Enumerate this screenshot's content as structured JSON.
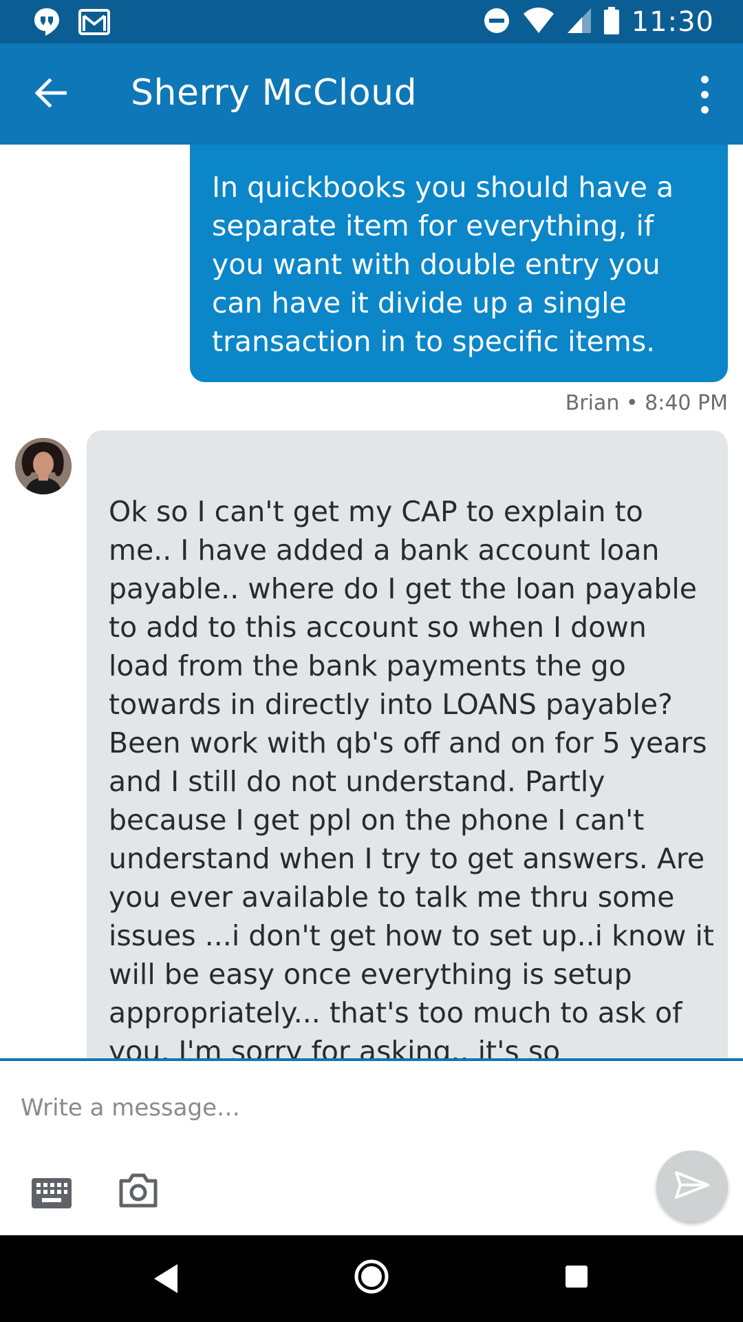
{
  "status_bar": {
    "time": "11:30",
    "icons": [
      "hangouts-icon",
      "gmail-icon",
      "do-not-disturb-icon",
      "wifi-icon",
      "signal-icon",
      "battery-icon"
    ]
  },
  "app_bar": {
    "title": "Sherry McCloud",
    "back_icon": "arrow-back-icon",
    "menu_icon": "more-vert-icon"
  },
  "conversation": {
    "messages": [
      {
        "direction": "outgoing",
        "text": "In quickbooks you should have a separate item for everything, if you want with double entry you can have it divide up a single transaction in to specific items.",
        "meta": "Brian • 8:40 PM"
      },
      {
        "direction": "incoming",
        "sender_avatar": "avatar",
        "text": "Ok so I can't get my CAP to explain to me.. I have added a bank account loan payable.. where do I get the loan payable to add to this account so when I down load from the bank payments the go towards in directly into LOANS payable?  Been work with qb's off and on for 5 years and I still do not understand. Partly because I get ppl on the phone I can't understand when I try to get answers.  Are you ever available to talk me thru some issues ...i don't get how to set up..i know it will be easy once everything is setup appropriately... that's too much to ask of you, I'm sorry for asking.. it's so frustrating.. if I had someone that could just explain in a simple way, I think I would be ok lol"
      }
    ]
  },
  "composer": {
    "placeholder": "Write a message…",
    "value": "",
    "keyboard_icon": "keyboard-icon",
    "camera_icon": "camera-icon",
    "send_icon": "send-icon"
  },
  "nav_bar": {
    "buttons": [
      "nav-back-icon",
      "nav-home-icon",
      "nav-recents-icon"
    ]
  },
  "colors": {
    "status_bar": "#0b5e93",
    "app_bar": "#0d77b7",
    "outgoing_bubble": "#0a86c9",
    "incoming_bubble": "#e3e6e9",
    "meta_text": "#6c6c6c"
  }
}
